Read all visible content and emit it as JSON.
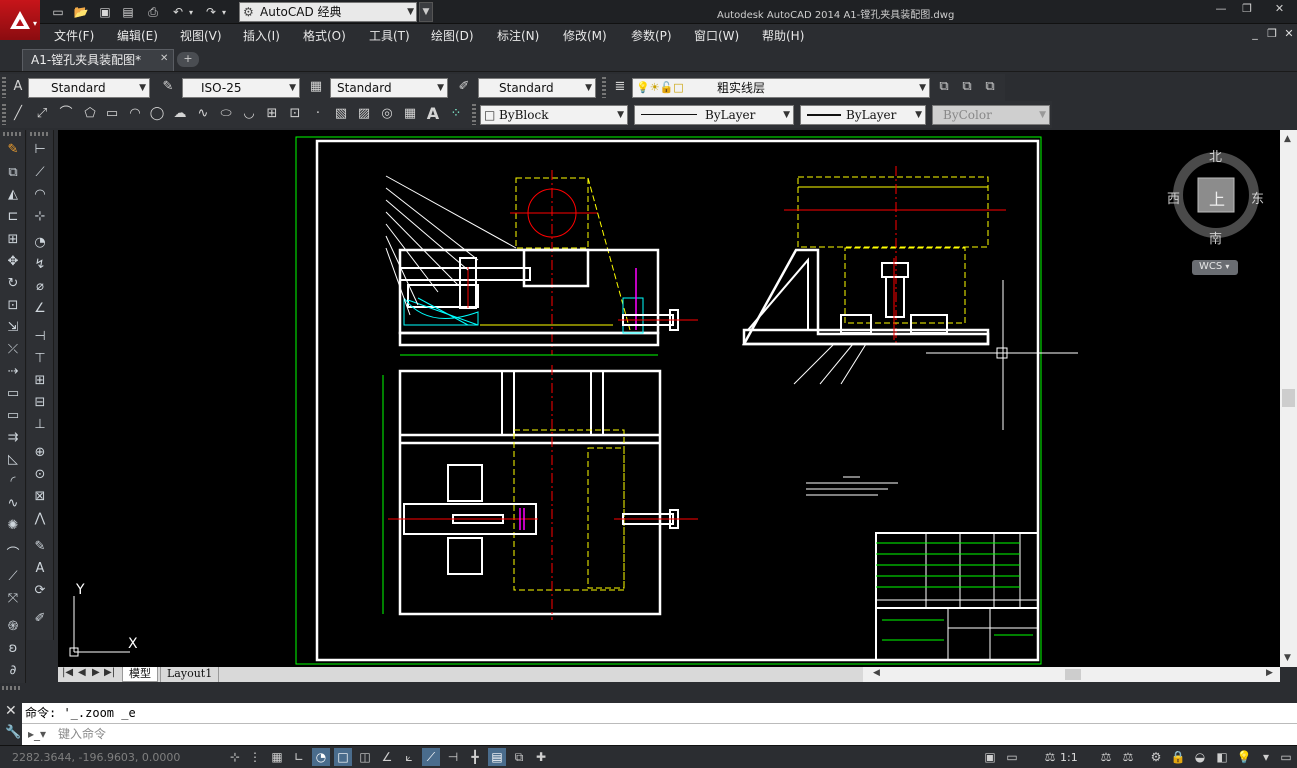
{
  "app": {
    "workspace": "AutoCAD 经典",
    "window_title": "Autodesk AutoCAD 2014    A1-镗孔夹具装配图.dwg"
  },
  "menu": [
    "文件(F)",
    "编辑(E)",
    "视图(V)",
    "插入(I)",
    "格式(O)",
    "工具(T)",
    "绘图(D)",
    "标注(N)",
    "修改(M)",
    "参数(P)",
    "窗口(W)",
    "帮助(H)"
  ],
  "document_tab": "A1-镗孔夹具装配图*",
  "styles_toolbar": {
    "text_style": "Standard",
    "dim_style": "ISO-25",
    "table_style": "Standard",
    "multileader_style": "Standard"
  },
  "layer_toolbar": {
    "current_layer": "粗实线层"
  },
  "properties_toolbar": {
    "color": "ByBlock",
    "linetype": "ByLayer",
    "lineweight": "ByLayer",
    "plot_style": "ByColor"
  },
  "viewcube": {
    "north": "北",
    "south": "南",
    "east": "东",
    "west": "西",
    "face": "上",
    "ucs": "WCS"
  },
  "ucs_icon": {
    "x": "X",
    "y": "Y"
  },
  "layout_tabs": [
    "模型",
    "Layout1"
  ],
  "command": {
    "history": "命令: '_.zoom _e",
    "placeholder": "键入命令"
  },
  "status": {
    "coordinates": "2282.3644, -196.9603, 0.0000",
    "annotation_scale": "1:1"
  },
  "colors": {
    "canvas": "#000000",
    "geometry_white": "#ffffff",
    "centerline_red": "#ff0000",
    "hidden_yellow": "#ffff00",
    "green": "#00ff00",
    "cyan": "#00ffff",
    "magenta": "#ff00ff",
    "chrome": "#2b2d31"
  },
  "icons": {
    "title_quick_access": [
      "new-icon",
      "open-icon",
      "save-icon",
      "save-as-icon",
      "plot-icon",
      "undo-icon",
      "redo-icon"
    ],
    "draw_toolbar": [
      "line-icon",
      "construction-line-icon",
      "polyline-icon",
      "polygon-icon",
      "rectangle-icon",
      "arc-icon",
      "circle-icon",
      "revision-cloud-icon",
      "spline-icon",
      "ellipse-icon",
      "ellipse-arc-icon",
      "insert-block-icon",
      "make-block-icon",
      "point-icon",
      "hatch-icon",
      "gradient-icon",
      "region-icon",
      "table-icon",
      "multiline-text-icon",
      "add-selected-icon"
    ]
  }
}
